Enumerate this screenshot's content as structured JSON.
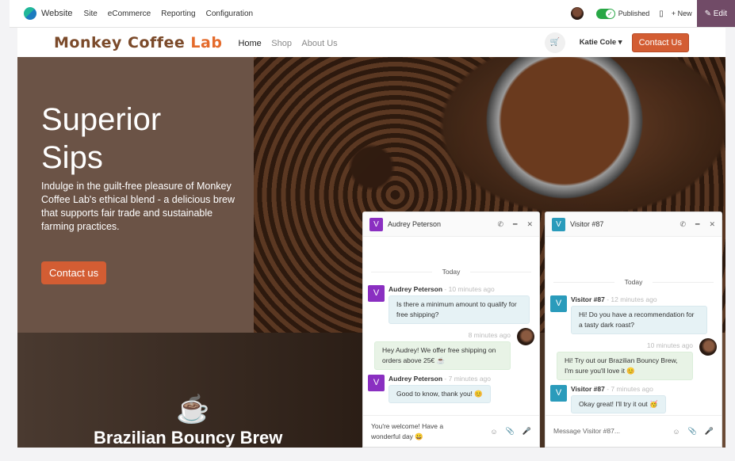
{
  "topbar": {
    "brand": "Website",
    "menu": [
      "Site",
      "eCommerce",
      "Reporting",
      "Configuration"
    ],
    "published": "Published",
    "new": "New",
    "edit": "Edit"
  },
  "header": {
    "logo": "Monkey Coffee Lab",
    "nav": [
      "Home",
      "Shop",
      "About Us"
    ],
    "user": "Katie Cole",
    "contact": "Contact Us"
  },
  "hero": {
    "title1": "Superior",
    "title2": "Sips",
    "description": "Indulge in the guilt-free pleasure of Monkey Coffee Lab's ethical blend - a delicious brew that supports fair trade and sustainable farming practices.",
    "button": "Contact us",
    "section2_title": "Brazilian Bouncy Brew"
  },
  "colors": {
    "accent": "#d35d33",
    "edit": "#714b67",
    "audrey_avatar": "#8a2fc1",
    "visitor_avatar": "#2a9bbb"
  },
  "chats": [
    {
      "name": "Audrey Peterson",
      "initial": "V",
      "date": "Today",
      "messages": [
        {
          "author": "Audrey Peterson",
          "time": "10 minutes ago",
          "text": "Is there a minimum amount to qualify for free shipping?"
        },
        {
          "time": "8 minutes ago",
          "text": "Hey Audrey! We offer free shipping on orders above 25€ ☕"
        },
        {
          "author": "Audrey Peterson",
          "time": "7 minutes ago",
          "text": "Good to know, thank you! 😊"
        }
      ],
      "input": "You're welcome! Have a wonderful day 😀"
    },
    {
      "name": "Visitor #87",
      "initial": "V",
      "date": "Today",
      "messages": [
        {
          "author": "Visitor #87",
          "time": "12 minutes ago",
          "text": "Hi! Do you have a recommendation for a tasty dark roast?"
        },
        {
          "time": "10 minutes ago",
          "text": "Hi! Try out our Brazilian Bouncy Brew, I'm sure you'll love it 😊"
        },
        {
          "author": "Visitor #87",
          "time": "7 minutes ago",
          "text": "Okay great! I'll try it out 🥳"
        }
      ],
      "placeholder": "Message Visitor #87..."
    }
  ]
}
